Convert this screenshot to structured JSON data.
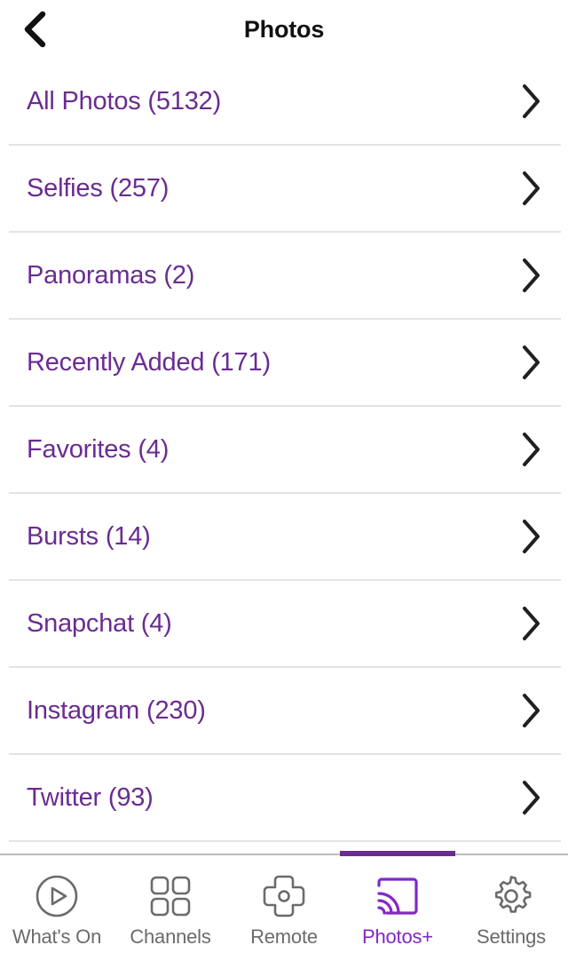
{
  "header": {
    "title": "Photos",
    "back_icon": "chevron-left-icon"
  },
  "colors": {
    "accent_purple": "#6A2C91",
    "active_tab_purple": "#8228C8",
    "divider_gray": "#e3e3e4",
    "tab_label_gray": "#6b6b6b",
    "chevron_dark": "#231f20",
    "background": "#ffffff"
  },
  "list": {
    "items": [
      {
        "label": "All Photos (5132)",
        "name": "All Photos",
        "count": 5132,
        "chevron": "chevron-right-icon"
      },
      {
        "label": "Selfies (257)",
        "name": "Selfies",
        "count": 257,
        "chevron": "chevron-right-icon"
      },
      {
        "label": "Panoramas (2)",
        "name": "Panoramas",
        "count": 2,
        "chevron": "chevron-right-icon"
      },
      {
        "label": "Recently Added (171)",
        "name": "Recently Added",
        "count": 171,
        "chevron": "chevron-right-icon"
      },
      {
        "label": "Favorites (4)",
        "name": "Favorites",
        "count": 4,
        "chevron": "chevron-right-icon"
      },
      {
        "label": "Bursts (14)",
        "name": "Bursts",
        "count": 14,
        "chevron": "chevron-right-icon"
      },
      {
        "label": "Snapchat (4)",
        "name": "Snapchat",
        "count": 4,
        "chevron": "chevron-right-icon"
      },
      {
        "label": "Instagram (230)",
        "name": "Instagram",
        "count": 230,
        "chevron": "chevron-right-icon"
      },
      {
        "label": "Twitter (93)",
        "name": "Twitter",
        "count": 93,
        "chevron": "chevron-right-icon"
      }
    ]
  },
  "tabbar": {
    "active_index": 3,
    "tabs": [
      {
        "label": "What's On",
        "icon": "play-circle-icon",
        "active": false
      },
      {
        "label": "Channels",
        "icon": "grid-squares-icon",
        "active": false
      },
      {
        "label": "Remote",
        "icon": "dpad-icon",
        "active": false
      },
      {
        "label": "Photos+",
        "icon": "cast-screen-icon",
        "active": true
      },
      {
        "label": "Settings",
        "icon": "gear-icon",
        "active": false
      }
    ]
  }
}
